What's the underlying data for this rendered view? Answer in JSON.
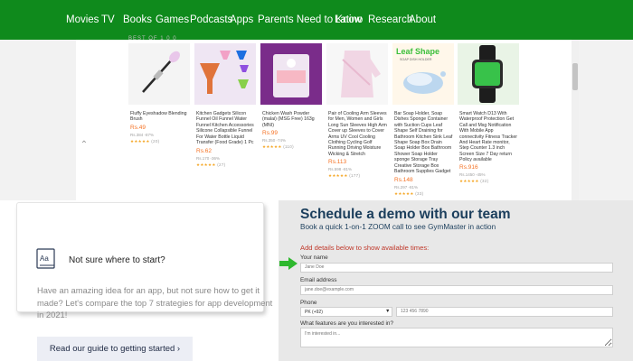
{
  "topnav": {
    "items": [
      "Movies",
      "TV",
      "Books",
      "Games",
      "Podcasts",
      "Apps",
      "Parents Need to Know",
      "Latino",
      "Research",
      "About"
    ]
  },
  "strip": {
    "section_label": "BEST OF 1 0 0"
  },
  "products": [
    {
      "title": "Fluffy Eyeshadow Blending Brush",
      "price": "Rs.49",
      "old_price": "Rs.384 -87%",
      "rating_count": "(20)"
    },
    {
      "title": "Kitchen Gadgets Silicon Funnel Oil Funnel Water Funnel Kitchen Accessories Silicone Collapsible Funnel For Water Bottle Liquid Transfer (Food Grade) 1 Pc",
      "price": "Rs.62",
      "old_price": "Rs.170 -36%",
      "rating_count": "(27)"
    },
    {
      "title": "Chicken Wash Powder (malai) (MSG Free) 163g (MNI)",
      "price": "Rs.99",
      "old_price": "Rs.350 -74%",
      "rating_count": "(110)"
    },
    {
      "title": "Pair of Cooling Arm Sleeves for Men, Women and Girls Long Sun Sleeves High Arm Cover up Sleeves to Cover Arms UV Cool Cooling Clothing Cycling Golf Running Driving Moisture Wicking & Stretch",
      "price": "Rs.113",
      "old_price": "Rs.598 -81%",
      "rating_count": "(177)"
    },
    {
      "title": "Bar Soap Holder, Soap Dishes Sponge Container with Suction Cups Leaf Shape Self Draining for Bathroom Kitchen Sink Leaf Shape Soap Box Drain Soap Holder Box Bathroom Shower Soap Holder sponge Storage Tray Creative Storage Box Bathroom Supplies Gadget",
      "price": "Rs.148",
      "old_price": "Rs.297 -81%",
      "rating_count": "(33)"
    },
    {
      "title": "Smart Watch D13 With Waterproof Protection Get Call and Msg Notification With Mobile App connectivity Fitness Tracker And Heart Rate monitor, Step Counter 1.3 inch Screen Size 7 Day return Policy available",
      "price": "Rs.916",
      "old_price": "Rs.1450 -45%",
      "rating_count": "(32)"
    }
  ],
  "product_banner_text": "Leaf Shape",
  "product_banner_sub": "SOAP DISH HOLDER",
  "stars": "★★★★★",
  "guide": {
    "title": "Not sure where to start?",
    "body": "Have an amazing idea for an app, but not sure how to get it made? Let's compare the top 7 strategies for app development in 2021!",
    "button_label": "Read our guide to getting started ›",
    "icon_text": "Aa"
  },
  "demo": {
    "title": "Schedule a demo with our team",
    "subtitle": "Book a quick 1-on-1 ZOOM call to see GymMaster in action",
    "cta": "Add details below to show available times:",
    "name_label": "Your name",
    "name_placeholder": "Jane Doe",
    "email_label": "Email address",
    "email_placeholder": "jane.doe@example.com",
    "phone_label": "Phone",
    "country_value": "PK (+92)",
    "phone_placeholder": "123 456 7890",
    "features_label": "What features are you interested in?",
    "features_placeholder": "I'm interested in..."
  },
  "colors": {
    "nav_green": "#0f8a1c",
    "price_orange": "#f57224",
    "demo_title": "#1b3e5c",
    "cta_red": "#c0392b",
    "arrow_green": "#2eb82e"
  }
}
